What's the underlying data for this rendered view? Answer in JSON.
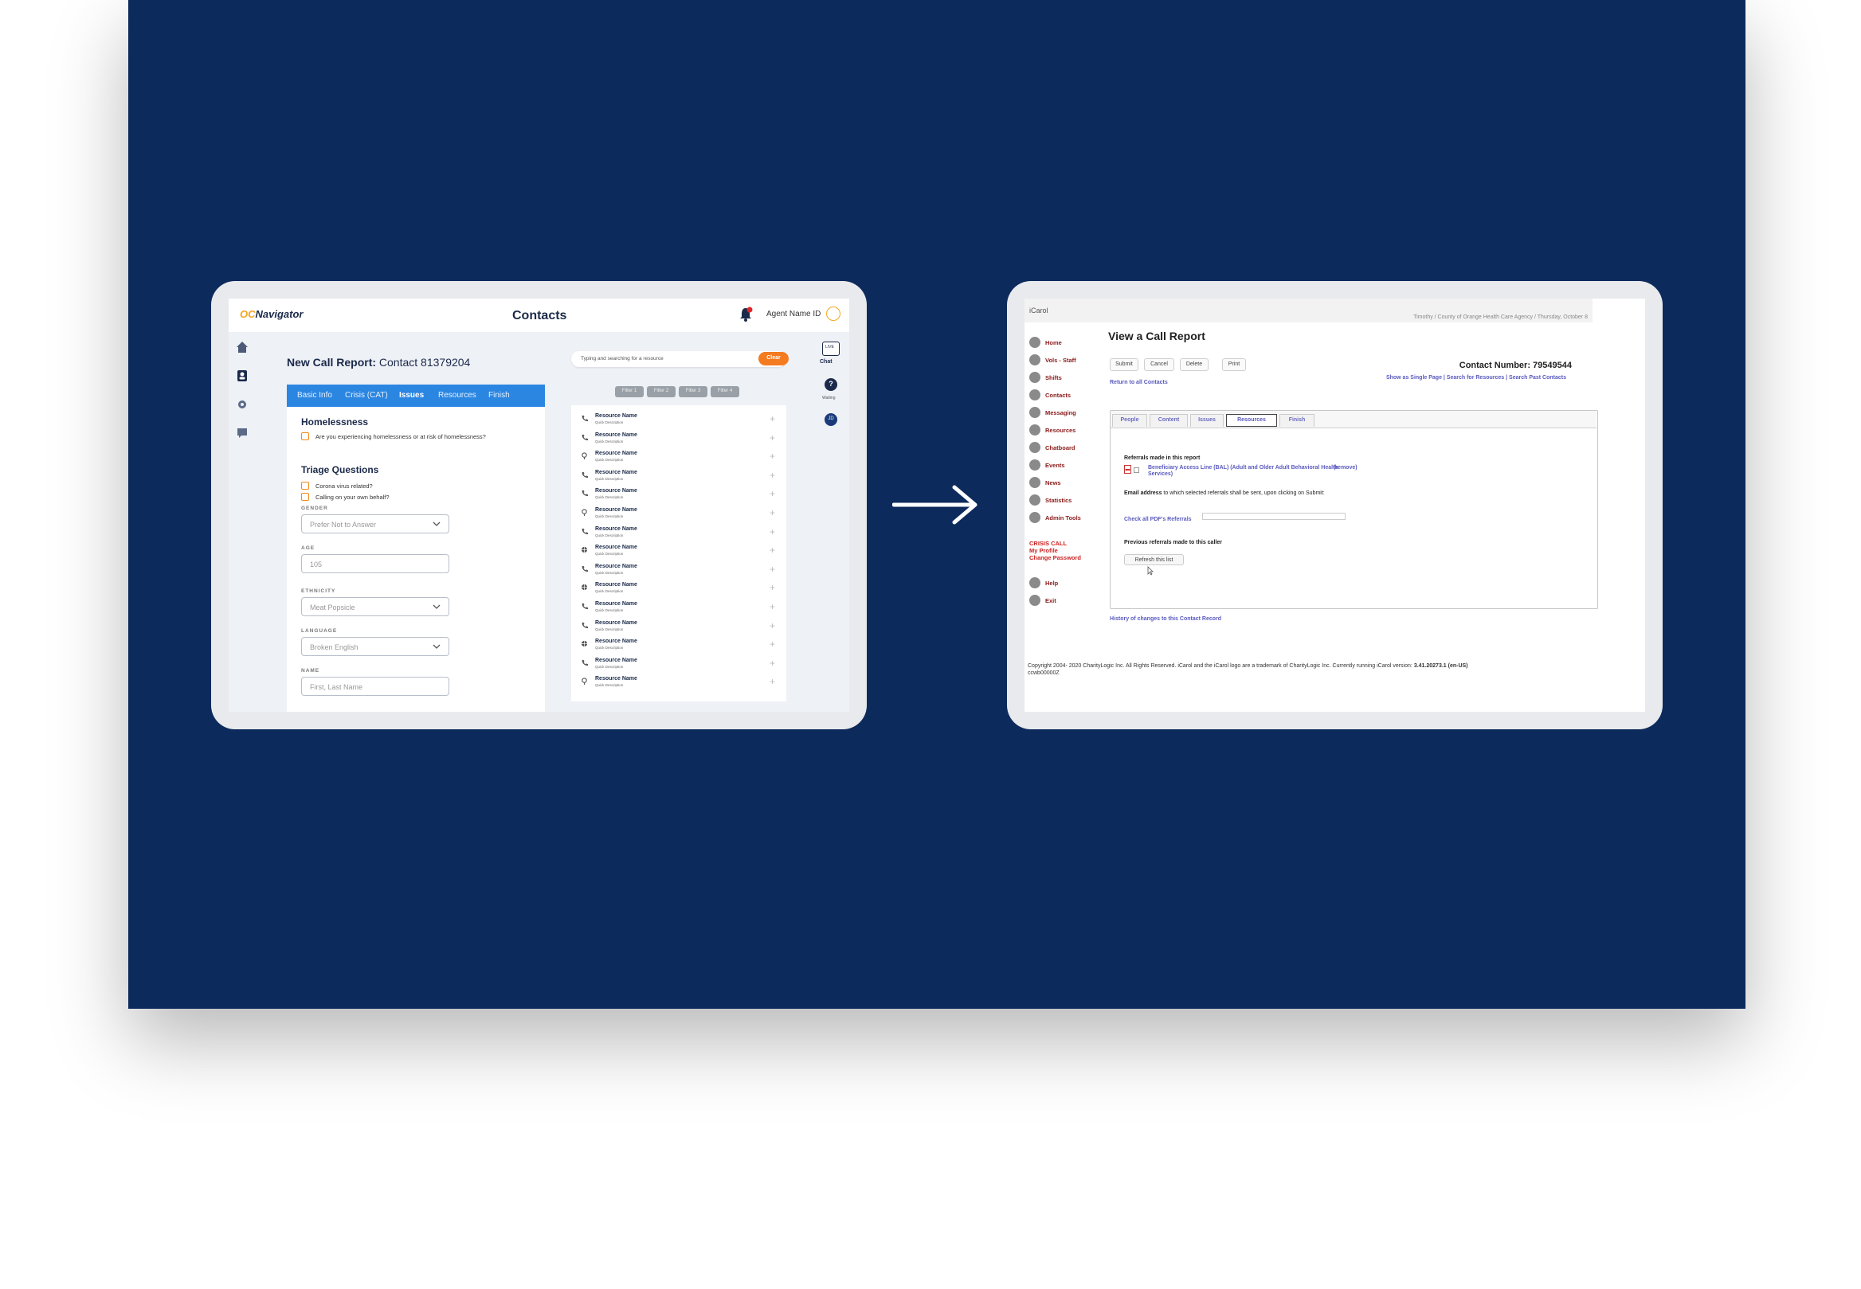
{
  "left_app": {
    "logo_prefix": "OC",
    "logo_suffix": "Navigator",
    "header_title": "Contacts",
    "notification_count": "",
    "agent_name": "Agent Name ID",
    "report_title_bold": "New Call Report:",
    "report_title_rest": "Contact 81379204",
    "tabs": [
      "Basic Info",
      "Crisis (CAT)",
      "Issues",
      "Resources",
      "Finish"
    ],
    "active_tab": "Issues",
    "section1_title": "Homelessness",
    "section1_question": "Are you experiencing homelessness or at risk of homelessness?",
    "section2_title": "Triage Questions",
    "triage_q1": "Corona virus related?",
    "triage_q2": "Calling on your own behalf?",
    "gender_label": "GENDER",
    "gender_value": "Prefer Not to Answer",
    "age_label": "AGE",
    "age_value": "105",
    "ethnicity_label": "ETHNICITY",
    "ethnicity_value": "Meat Popsicle",
    "language_label": "LANGUAGE",
    "language_value": "Broken English",
    "name_label": "NAME",
    "name_placeholder": "First, Last Name",
    "search_placeholder": "Typing and searching for a resource",
    "clear_label": "Clear",
    "filters": [
      "Filter 1",
      "Filter 2",
      "Filter 3",
      "Filter 4"
    ],
    "resources": [
      {
        "icon": "phone-icon",
        "name": "Resource Name",
        "desc": "Quick Description"
      },
      {
        "icon": "phone-icon",
        "name": "Resource Name",
        "desc": "Quick Description"
      },
      {
        "icon": "location-icon",
        "name": "Resource Name",
        "desc": "Quick Description"
      },
      {
        "icon": "phone-icon",
        "name": "Resource Name",
        "desc": "Quick Description"
      },
      {
        "icon": "phone-icon",
        "name": "Resource Name",
        "desc": "Quick Description"
      },
      {
        "icon": "location-icon",
        "name": "Resource Name",
        "desc": "Quick Description"
      },
      {
        "icon": "phone-icon",
        "name": "Resource Name",
        "desc": "Quick Description"
      },
      {
        "icon": "globe-icon",
        "name": "Resource Name",
        "desc": "Quick Description"
      },
      {
        "icon": "phone-icon",
        "name": "Resource Name",
        "desc": "Quick Description"
      },
      {
        "icon": "globe-icon",
        "name": "Resource Name",
        "desc": "Quick Description"
      },
      {
        "icon": "phone-icon",
        "name": "Resource Name",
        "desc": "Quick Description"
      },
      {
        "icon": "phone-icon",
        "name": "Resource Name",
        "desc": "Quick Description"
      },
      {
        "icon": "globe-icon",
        "name": "Resource Name",
        "desc": "Quick Description"
      },
      {
        "icon": "phone-icon",
        "name": "Resource Name",
        "desc": "Quick Description"
      },
      {
        "icon": "location-icon",
        "name": "Resource Name",
        "desc": "Quick Description"
      }
    ],
    "chat_icon_text": "LIVE",
    "chat_label": "Chat",
    "waiting_label": "Waiting",
    "status_text": "JD",
    "accent_color": "#2b86e2",
    "brand_orange": "#f47b20"
  },
  "right_app": {
    "logo": "iCarol",
    "breadcrumb": "Timothy / County of Orange Health Care Agency / Thursday, October 8",
    "nav": [
      "Home",
      "Vols - Staff",
      "Shifts",
      "Contacts",
      "Messaging",
      "Resources",
      "Chatboard",
      "Events",
      "News",
      "Statistics",
      "Admin Tools"
    ],
    "nav_red": [
      "CRISIS CALL",
      "My Profile",
      "Change Password"
    ],
    "nav_bottom": [
      "Help",
      "Exit"
    ],
    "page_title": "View a Call Report",
    "buttons": [
      "Submit",
      "Cancel",
      "Delete",
      "Print"
    ],
    "contact_number": "Contact Number: 79549544",
    "return_link": "Return to all Contacts",
    "right_links": "Show as Single Page | Search for Resources | Search Past Contacts",
    "tabs": [
      "People",
      "Content",
      "Issues",
      "Resources",
      "Finish"
    ],
    "active_tab": "Resources",
    "referrals_heading": "Referrals made in this report",
    "referral_name": "Beneficiary Access Line (BAL) (Adult and Older Adult Behavioral Health Services)",
    "remove_label": "(remove)",
    "email_bold": "Email address",
    "email_rest": " to which selected referrals shall be sent, upon clicking on Submit:",
    "check_pdf": "Check all PDF's Referrals",
    "previous_heading": "Previous referrals made to this caller",
    "refresh_label": "Refresh this list",
    "history_link": "History of changes to this Contact Record",
    "copyright": "Copyright 2004- 2020 CharityLogic Inc. All Rights Reserved. iCarol and the iCarol logo are a trademark of CharityLogic Inc. Currently running iCarol version:",
    "version": "3.41.20273.1 (en-US)",
    "build": "ccwb00000Z"
  }
}
